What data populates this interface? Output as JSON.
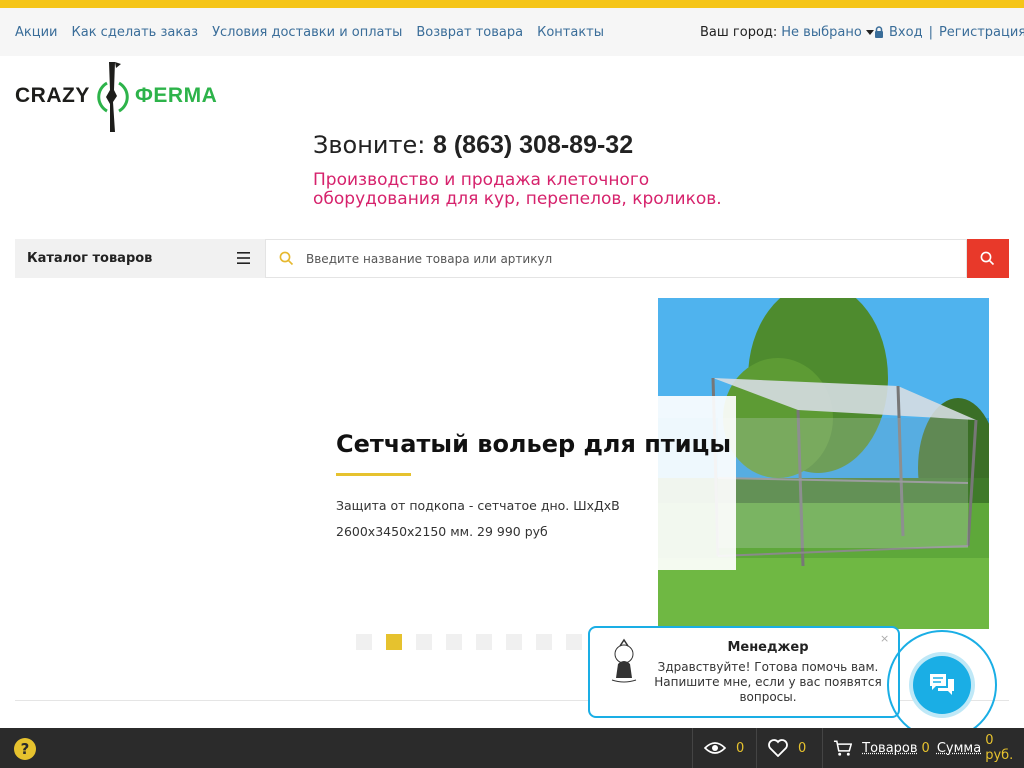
{
  "colors": {
    "accent": "#f5c518",
    "link": "#3a6d99",
    "tagline": "#d6226c",
    "search_button": "#e8392a",
    "chat": "#1aaee5"
  },
  "topnav": {
    "links": [
      "Акции",
      "Как сделать заказ",
      "Условия доставки и оплаты",
      "Возврат товара",
      "Контакты"
    ],
    "city_label": "Ваш город:",
    "city_value": "Не выбрано",
    "login": "Вход",
    "separator": "|",
    "register": "Регистрация"
  },
  "logo": {
    "left": "CRAZY",
    "right": "ФERMA"
  },
  "header": {
    "phone_label": "Звоните:",
    "phone_number": "8 (863) 308-89-32",
    "tagline": "Производство и продажа клеточного оборудования для кур, перепелов, кроликов."
  },
  "catalog": {
    "label": "Каталог товаров"
  },
  "search": {
    "placeholder": "Введите название товара или артикул"
  },
  "banner": {
    "title": "Сетчатый вольер для птицы",
    "text": "Защита от подкопа - сетчатое дно. ШхДхВ 2600х3450х2150 мм. 29 990 руб",
    "active_slide": 2,
    "slide_count": 8
  },
  "chat": {
    "name": "Менеджер",
    "message": "Здравствуйте! Готова помочь вам. Напишите мне, если у вас появятся вопросы.",
    "close": "×"
  },
  "footer": {
    "help": "?",
    "viewed_count": "0",
    "favorites_count": "0",
    "cart_label": "Товаров",
    "cart_count": "0",
    "sum_label": "Сумма",
    "sum_value": "0 руб."
  }
}
